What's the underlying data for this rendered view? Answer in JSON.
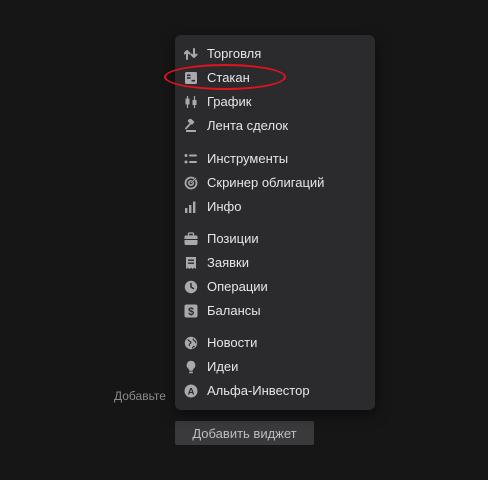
{
  "background": {
    "hint_text": "Добавьте",
    "add_widget_label": "Добавить виджет"
  },
  "menu": {
    "items": [
      {
        "label": "Торговля",
        "icon": "trade-arrows-icon"
      },
      {
        "label": "Стакан",
        "icon": "order-book-icon"
      },
      {
        "label": "График",
        "icon": "candlestick-chart-icon"
      },
      {
        "label": "Лента сделок",
        "icon": "gavel-icon"
      },
      {
        "label": "Инструменты",
        "icon": "list-icon"
      },
      {
        "label": "Скринер облигаций",
        "icon": "target-icon"
      },
      {
        "label": "Инфо",
        "icon": "bar-chart-icon"
      },
      {
        "label": "Позиции",
        "icon": "briefcase-icon"
      },
      {
        "label": "Заявки",
        "icon": "receipt-icon"
      },
      {
        "label": "Операции",
        "icon": "clock-icon"
      },
      {
        "label": "Балансы",
        "icon": "dollar-icon"
      },
      {
        "label": "Новости",
        "icon": "globe-icon"
      },
      {
        "label": "Идеи",
        "icon": "lightbulb-icon"
      },
      {
        "label": "Альфа-Инвестор",
        "icon": "alfa-logo-icon"
      }
    ]
  },
  "annotation": {
    "highlight_color": "#e0141e",
    "highlighted_item": "Стакан"
  },
  "colors": {
    "page_bg": "#161616",
    "menu_bg": "#2b2b2e",
    "menu_text": "#e6e6e8",
    "icon": "#a9a9ad"
  }
}
